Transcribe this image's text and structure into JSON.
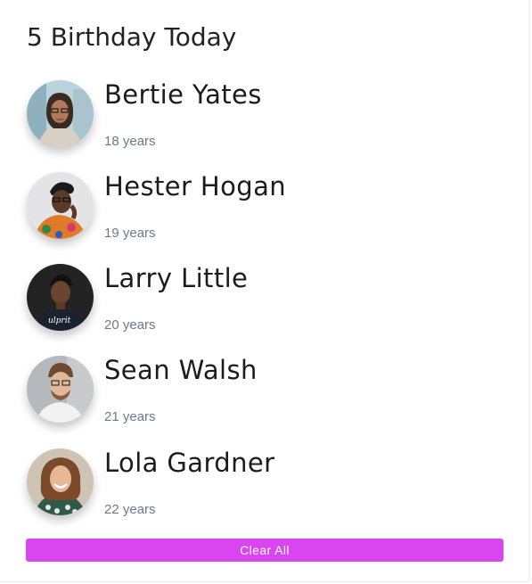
{
  "header": {
    "title": "5 Birthday Today"
  },
  "people": [
    {
      "name": "Bertie Yates",
      "age": "18 years"
    },
    {
      "name": "Hester Hogan",
      "age": "19 years"
    },
    {
      "name": "Larry Little",
      "age": "20 years"
    },
    {
      "name": "Sean Walsh",
      "age": "21 years"
    },
    {
      "name": "Lola Gardner",
      "age": "22 years"
    }
  ],
  "actions": {
    "clear_label": "Clear All"
  },
  "colors": {
    "accent": "#d946ef",
    "title_text": "#222222",
    "age_text": "#6b7a8a"
  }
}
